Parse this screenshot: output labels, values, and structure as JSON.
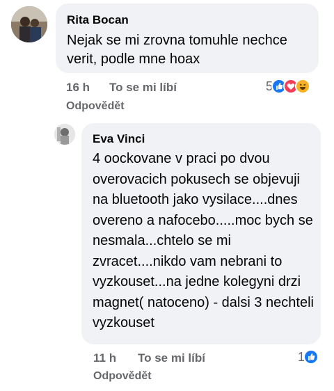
{
  "comments": [
    {
      "author": "Rita Bocan",
      "text": "Nejak se mi zrovna tomuhle nechce verit, podle mne hoax",
      "time": "16 h",
      "like_label": "To se mi líbí",
      "reply_label": "Odpovědět",
      "reaction_count": "5",
      "reactions": [
        "like-icon",
        "love-icon",
        "haha-icon"
      ]
    },
    {
      "author": "Eva Vinci",
      "text": "4 oockovane v praci po dvou overovacich pokusech se objevuji  na bluetooth jako vysilace....dnes overeno a nafocebo.....moc bych se nesmala...chtelo se mi zvracet....nikdo vam nebrani to vyzkouset...na jedne kolegyni drzi magnet( natoceno) - dalsi 3 nechteli vyzkouset",
      "time": "11 h",
      "like_label": "To se mi líbí",
      "reply_label": "Odpovědět",
      "reaction_count": "1",
      "reactions": [
        "like-icon"
      ]
    }
  ],
  "colors": {
    "bubble": "#f0f2f5",
    "meta": "#65676b",
    "like": "#1877f2",
    "love": "#f33e58",
    "haha": "#f7b125"
  }
}
